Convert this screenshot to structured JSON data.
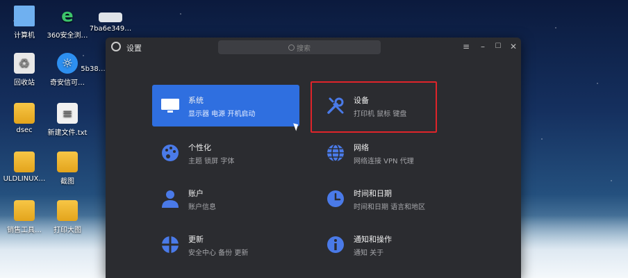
{
  "desktop": {
    "icons": [
      {
        "label": "计算机",
        "icon": "computer-icon"
      },
      {
        "label": "360安全浏…",
        "icon": "browser-e-icon"
      },
      {
        "label": "7ba6e349…",
        "icon": "package-icon"
      },
      {
        "label": "回收站",
        "icon": "trash-icon"
      },
      {
        "label": "奇安信可…",
        "icon": "browser-icon"
      },
      {
        "label": "5b38…",
        "icon": "package-icon"
      },
      {
        "label": "dsec",
        "icon": "home-folder-icon"
      },
      {
        "label": "新建文件.txt",
        "icon": "text-file-icon"
      },
      {
        "label": "ULDLINUX…",
        "icon": "folder-icon"
      },
      {
        "label": "截图",
        "icon": "folder-icon"
      },
      {
        "label": "销售工具…",
        "icon": "folder-icon"
      },
      {
        "label": "打印大图",
        "icon": "folder-icon"
      }
    ]
  },
  "window": {
    "title": "设置",
    "search_placeholder": "搜索",
    "controls": {
      "menu": "≡",
      "minimize": "–",
      "maximize": "☐",
      "close": "✕"
    }
  },
  "settings": [
    {
      "name": "系统",
      "sub": "显示器  电源  开机启动",
      "icon": "monitor-icon",
      "active": true
    },
    {
      "name": "设备",
      "sub": "打印机  鼠标  键盘",
      "icon": "tools-icon",
      "highlighted": true
    },
    {
      "name": "个性化",
      "sub": "主题  锁屏  字体",
      "icon": "palette-icon"
    },
    {
      "name": "网络",
      "sub": "网络连接  VPN  代理",
      "icon": "globe-icon"
    },
    {
      "name": "账户",
      "sub": "账户信息",
      "icon": "user-icon"
    },
    {
      "name": "时间和日期",
      "sub": "时间和日期  语言和地区",
      "icon": "clock-icon"
    },
    {
      "name": "更新",
      "sub": "安全中心  备份  更新",
      "icon": "update-icon"
    },
    {
      "name": "通知和操作",
      "sub": "通知  关于",
      "icon": "info-icon"
    }
  ],
  "colors": {
    "accent": "#2f6fe0",
    "icon_blue": "#4a7ae8",
    "highlight": "#e0242a"
  }
}
